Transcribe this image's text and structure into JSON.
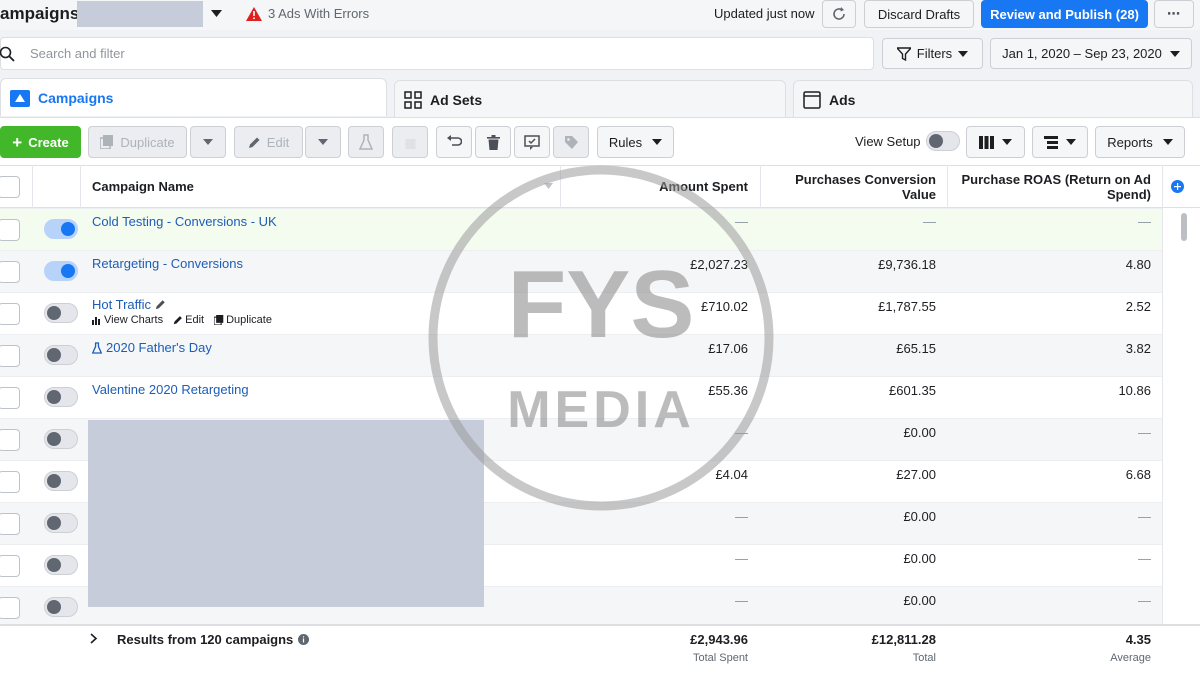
{
  "topbar": {
    "title": "ampaigns",
    "errors_text": "3 Ads With Errors",
    "updated_text": "Updated just now",
    "discard_label": "Discard Drafts",
    "publish_label": "Review and Publish (28)",
    "more_label": "⋯"
  },
  "search": {
    "placeholder": "Search and filter"
  },
  "filters_label": "Filters",
  "date_range": "Jan 1, 2020 – Sep 23, 2020",
  "tabs": [
    {
      "label": "Campaigns",
      "active": true
    },
    {
      "label": "Ad Sets",
      "active": false
    },
    {
      "label": "Ads",
      "active": false
    }
  ],
  "toolbar": {
    "create_label": "Create",
    "duplicate_label": "Duplicate",
    "edit_label": "Edit",
    "rules_label": "Rules",
    "view_setup_label": "View Setup",
    "reports_label": "Reports"
  },
  "table": {
    "columns": {
      "name": "Campaign Name",
      "spent": "Amount Spent",
      "pcv": "Purchases Conversion Value",
      "roas": "Purchase ROAS (Return on Ad Spend)"
    },
    "rows": [
      {
        "name": "Cold Testing - Conversions - UK",
        "on": true,
        "spent": "—",
        "pcv": "—",
        "roas": "—"
      },
      {
        "name": "Retargeting - Conversions",
        "on": true,
        "spent": "£2,027.23",
        "pcv": "£9,736.18",
        "roas": "4.80"
      },
      {
        "name": "Hot Traffic",
        "on": false,
        "spent": "£710.02",
        "pcv": "£1,787.55",
        "roas": "2.52"
      },
      {
        "name": "2020 Father's Day",
        "on": false,
        "spent": "£17.06",
        "pcv": "£65.15",
        "roas": "3.82"
      },
      {
        "name": "Valentine 2020 Retargeting",
        "on": false,
        "spent": "£55.36",
        "pcv": "£601.35",
        "roas": "10.86"
      },
      {
        "name": "",
        "on": false,
        "spent": "—",
        "pcv": "£0.00",
        "roas": "—"
      },
      {
        "name": "",
        "on": false,
        "spent": "£4.04",
        "pcv": "£27.00",
        "roas": "6.68"
      },
      {
        "name": "",
        "on": false,
        "spent": "—",
        "pcv": "£0.00",
        "roas": "—"
      },
      {
        "name": "",
        "on": false,
        "spent": "—",
        "pcv": "£0.00",
        "roas": "—"
      },
      {
        "name": "",
        "on": false,
        "spent": "—",
        "pcv": "£0.00",
        "roas": "—"
      }
    ],
    "row_actions": {
      "view_charts": "View Charts",
      "edit": "Edit",
      "duplicate": "Duplicate"
    },
    "footer": {
      "label": "Results from 120 campaigns",
      "spent": "£2,943.96",
      "spent_sub": "Total Spent",
      "pcv": "£12,811.28",
      "pcv_sub": "Total",
      "roas": "4.35",
      "roas_sub": "Average"
    }
  },
  "watermark": {
    "line1": "FYS",
    "line2": "MEDIA"
  },
  "colors": {
    "accent": "#1877f2",
    "create": "#42b72a",
    "error": "#e02020",
    "link": "#1c5db8"
  }
}
